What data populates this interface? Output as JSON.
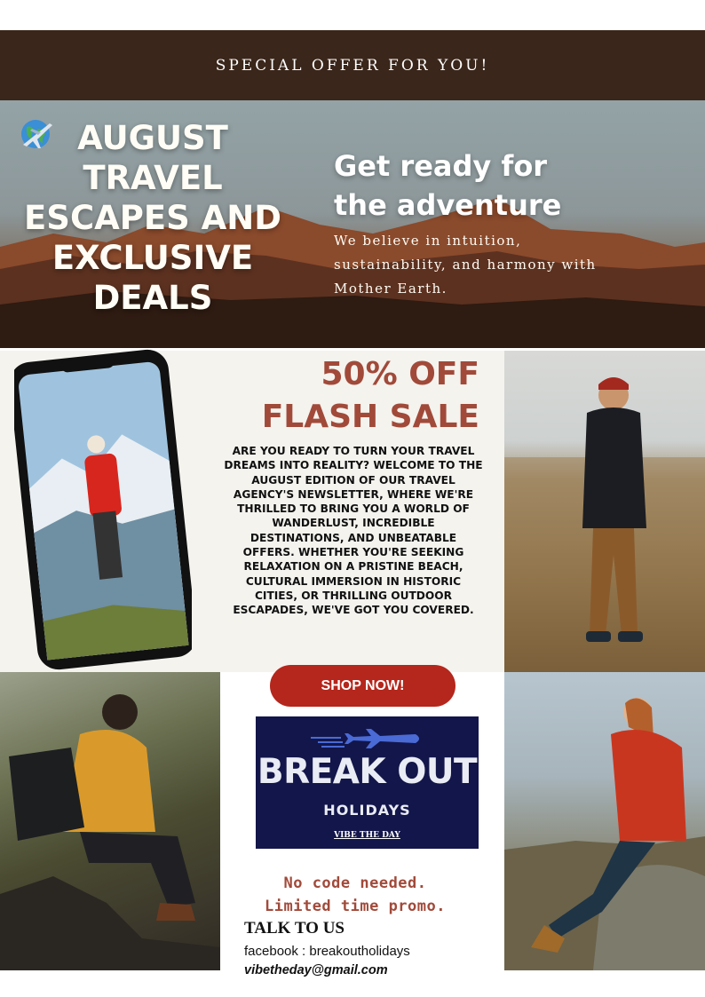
{
  "banner": {
    "text": "SPECIAL OFFER FOR YOU!"
  },
  "hero": {
    "title_lines": [
      "AUGUST",
      "TRAVEL",
      "ESCAPES AND",
      "EXCLUSIVE",
      "DEALS"
    ],
    "headline_lines": [
      "Get ready for",
      "the adventure"
    ],
    "subtext": "We believe in intuition, sustainability, and harmony with Mother Earth."
  },
  "sale": {
    "lines": [
      "50% OFF",
      "FLASH SALE"
    ]
  },
  "body": "Are you ready to turn your travel dreams into reality? Welcome to the August edition of our travel agency's newsletter, where we're thrilled to bring you a world of wanderlust, incredible destinations, and unbeatable offers. Whether you're seeking relaxation on a pristine beach, cultural immersion in historic cities, or thrilling outdoor escapades, we've got you covered.",
  "cta": {
    "label": "SHOP NOW!"
  },
  "logo": {
    "main": "BREAK OUT",
    "sub": "HOLIDAYS",
    "tagline": "VIBE THE DAY"
  },
  "promo": {
    "lines": [
      "No code needed.",
      "Limited time promo."
    ]
  },
  "contact": {
    "heading": "TALK TO US",
    "facebook": "facebook : breakoutholidays",
    "email": "vibetheday@gmail.com"
  },
  "icons": [
    "globe-icon",
    "airplane-icon",
    "logo-airplane-icon"
  ],
  "colors": {
    "banner": "#3a261a",
    "accent": "#a14a3a",
    "button": "#b5261c",
    "logo_bg": "#13164a"
  }
}
